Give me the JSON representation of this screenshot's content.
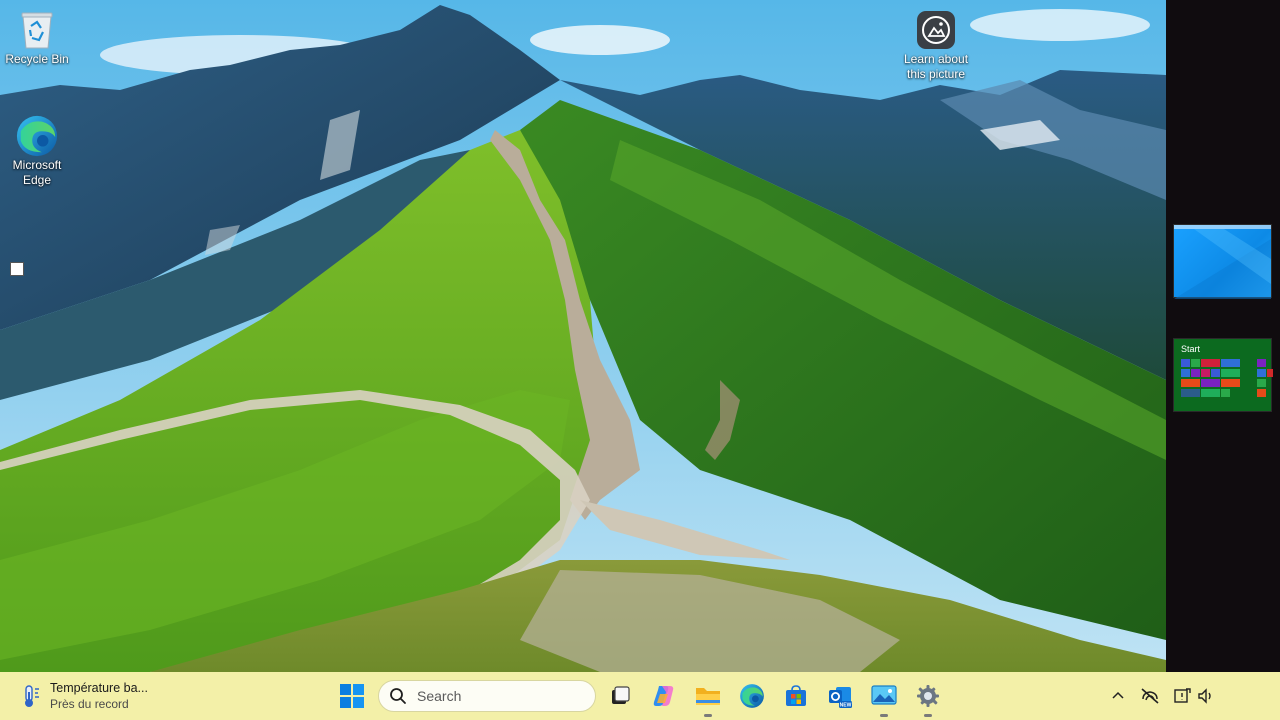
{
  "desktop": {
    "icons": [
      {
        "label": "Recycle Bin",
        "icon": "recycle-bin-icon"
      },
      {
        "label": "Microsoft\nEdge",
        "icon": "edge-icon"
      },
      {
        "label": "Learn about\nthis picture",
        "icon": "camera-icon"
      }
    ]
  },
  "side_panel": {
    "thumbnails": [
      {
        "name": "desktop-thumbnail"
      },
      {
        "name": "start-thumbnail",
        "label": "Start"
      }
    ]
  },
  "taskbar": {
    "weather": {
      "title": "Température ba...",
      "subtitle": "Près du record",
      "icon": "thermometer-icon"
    },
    "search": {
      "placeholder": "Search"
    },
    "apps": [
      {
        "name": "task-view",
        "icon": "task-view-icon"
      },
      {
        "name": "copilot",
        "icon": "copilot-icon"
      },
      {
        "name": "file-explorer",
        "icon": "folder-icon"
      },
      {
        "name": "edge",
        "icon": "edge-icon"
      },
      {
        "name": "microsoft-store",
        "icon": "store-icon"
      },
      {
        "name": "outlook-new",
        "icon": "outlook-icon"
      },
      {
        "name": "photos",
        "icon": "photos-icon"
      },
      {
        "name": "settings",
        "icon": "gear-icon"
      }
    ],
    "tray": [
      "chevron-up-icon",
      "network-off-icon",
      "notification-icon",
      "volume-icon"
    ]
  },
  "colors": {
    "taskbar_bg": "#f3f0a8",
    "accent": "#0078d4",
    "side_panel_bg": "#100c0f"
  }
}
